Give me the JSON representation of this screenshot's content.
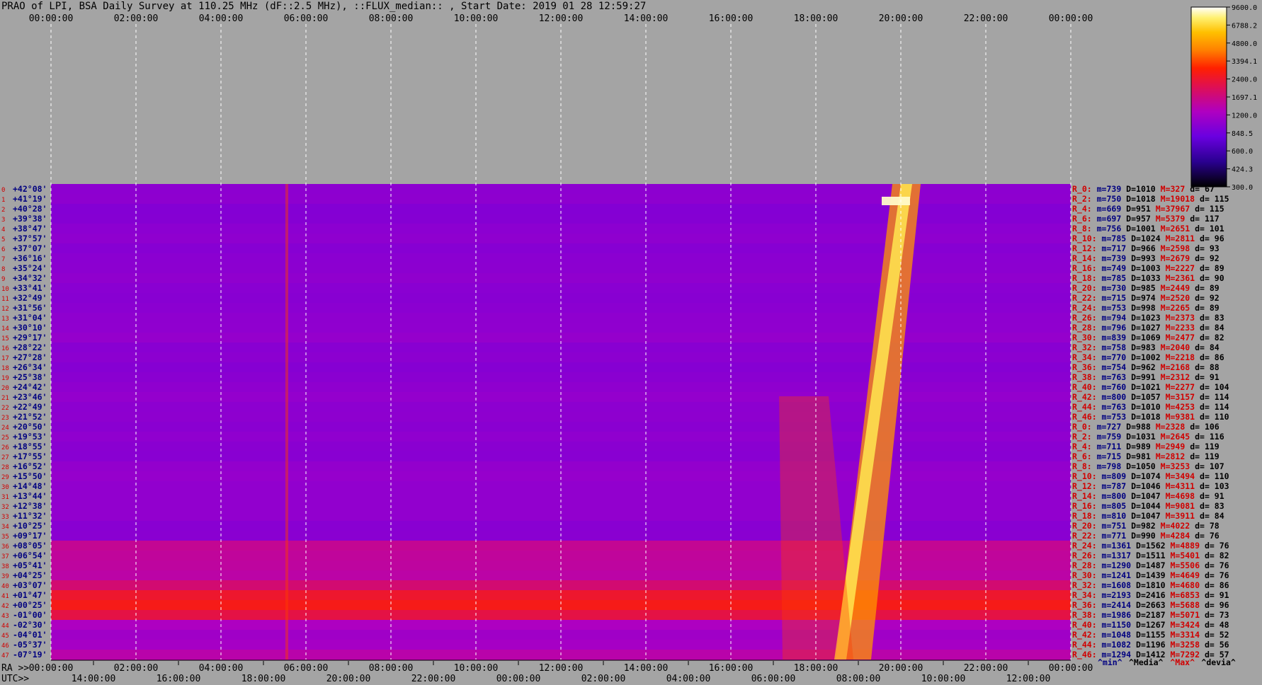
{
  "title": "PRAO of LPI, BSA Daily Survey at 110.25 MHz (dF::2.5 MHz), ::FLUX_median:: , Start Date: 2019 01 28 12:59:27",
  "colors": {
    "background": "#a4a4a4",
    "dec_label": "#000080",
    "row_index": "#d00000",
    "stat_beam": "#d00000",
    "stat_min": "#000080",
    "stat_median": "#000000",
    "stat_max": "#d00000",
    "stat_dev": "#000000"
  },
  "bottom_labels": {
    "ra": "RA >>",
    "utc": "UTC>>"
  },
  "legend_footer": [
    "^min^",
    "^Media^",
    "^Max^",
    "^devia^"
  ],
  "chart_data": {
    "type": "heatmap",
    "top_axis_ticks": [
      "00:00:00",
      "02:00:00",
      "04:00:00",
      "06:00:00",
      "08:00:00",
      "10:00:00",
      "12:00:00",
      "14:00:00",
      "16:00:00",
      "18:00:00",
      "20:00:00",
      "22:00:00",
      "00:00:00"
    ],
    "ra_ticks": [
      "00:00:00",
      "02:00:00",
      "04:00:00",
      "06:00:00",
      "08:00:00",
      "10:00:00",
      "12:00:00",
      "14:00:00",
      "16:00:00",
      "18:00:00",
      "20:00:00",
      "22:00:00",
      "00:00:00"
    ],
    "utc_ticks": [
      "14:00:00",
      "16:00:00",
      "18:00:00",
      "20:00:00",
      "22:00:00",
      "00:00:00",
      "02:00:00",
      "04:00:00",
      "06:00:00",
      "08:00:00",
      "10:00:00",
      "12:00:00"
    ],
    "colorbar": {
      "ticks": [
        "9600.0",
        "6788.2",
        "4800.0",
        "3394.1",
        "2400.0",
        "1697.1",
        "1200.0",
        "848.5",
        "600.0",
        "424.3",
        "300.0"
      ],
      "range": [
        300,
        9600
      ],
      "scale": "log"
    },
    "declinations": [
      "+42°08'",
      "+41°19'",
      "+40°28'",
      "+39°38'",
      "+38°47'",
      "+37°57'",
      "+37°07'",
      "+36°16'",
      "+35°24'",
      "+34°32'",
      "+33°41'",
      "+32°49'",
      "+31°56'",
      "+31°04'",
      "+30°10'",
      "+29°17'",
      "+28°22'",
      "+27°28'",
      "+26°34'",
      "+25°38'",
      "+24°42'",
      "+23°46'",
      "+22°49'",
      "+21°52'",
      "+20°50'",
      "+19°53'",
      "+18°55'",
      "+17°55'",
      "+16°52'",
      "+15°50'",
      "+14°48'",
      "+13°44'",
      "+12°38'",
      "+11°32'",
      "+10°25'",
      "+09°17'",
      "+08°05'",
      "+06°54'",
      "+05°41'",
      "+04°25'",
      "+03°07'",
      "+01°47'",
      "+00°25'",
      "-01°00'",
      "-02°30'",
      "-04°01'",
      "-05°37'",
      "-07°19'"
    ],
    "beam_stats": [
      {
        "beam": "R_0:",
        "min": "m=739",
        "median": "D=1010",
        "max": "M=327",
        "dev": "d= 67"
      },
      {
        "beam": "R_2:",
        "min": "m=750",
        "median": "D=1018",
        "max": "M=19018",
        "dev": "d= 115"
      },
      {
        "beam": "R_4:",
        "min": "m=669",
        "median": "D=951",
        "max": "M=37967",
        "dev": "d= 115"
      },
      {
        "beam": "R_6:",
        "min": "m=697",
        "median": "D=957",
        "max": "M=5379",
        "dev": "d= 117"
      },
      {
        "beam": "R_8:",
        "min": "m=756",
        "median": "D=1001",
        "max": "M=2651",
        "dev": "d= 101"
      },
      {
        "beam": "R_10:",
        "min": "m=785",
        "median": "D=1024",
        "max": "M=2811",
        "dev": "d= 96"
      },
      {
        "beam": "R_12:",
        "min": "m=717",
        "median": "D=966",
        "max": "M=2598",
        "dev": "d= 93"
      },
      {
        "beam": "R_14:",
        "min": "m=739",
        "median": "D=993",
        "max": "M=2679",
        "dev": "d= 92"
      },
      {
        "beam": "R_16:",
        "min": "m=749",
        "median": "D=1003",
        "max": "M=2227",
        "dev": "d= 89"
      },
      {
        "beam": "R_18:",
        "min": "m=785",
        "median": "D=1033",
        "max": "M=2361",
        "dev": "d= 90"
      },
      {
        "beam": "R_20:",
        "min": "m=730",
        "median": "D=985",
        "max": "M=2449",
        "dev": "d= 89"
      },
      {
        "beam": "R_22:",
        "min": "m=715",
        "median": "D=974",
        "max": "M=2520",
        "dev": "d= 92"
      },
      {
        "beam": "R_24:",
        "min": "m=753",
        "median": "D=998",
        "max": "M=2265",
        "dev": "d= 89"
      },
      {
        "beam": "R_26:",
        "min": "m=794",
        "median": "D=1023",
        "max": "M=2373",
        "dev": "d= 83"
      },
      {
        "beam": "R_28:",
        "min": "m=796",
        "median": "D=1027",
        "max": "M=2233",
        "dev": "d= 84"
      },
      {
        "beam": "R_30:",
        "min": "m=839",
        "median": "D=1069",
        "max": "M=2477",
        "dev": "d= 82"
      },
      {
        "beam": "R_32:",
        "min": "m=758",
        "median": "D=983",
        "max": "M=2040",
        "dev": "d= 84"
      },
      {
        "beam": "R_34:",
        "min": "m=770",
        "median": "D=1002",
        "max": "M=2218",
        "dev": "d= 86"
      },
      {
        "beam": "R_36:",
        "min": "m=754",
        "median": "D=962",
        "max": "M=2168",
        "dev": "d= 88"
      },
      {
        "beam": "R_38:",
        "min": "m=763",
        "median": "D=991",
        "max": "M=2312",
        "dev": "d= 91"
      },
      {
        "beam": "R_40:",
        "min": "m=760",
        "median": "D=1021",
        "max": "M=2277",
        "dev": "d= 104"
      },
      {
        "beam": "R_42:",
        "min": "m=800",
        "median": "D=1057",
        "max": "M=3157",
        "dev": "d= 114"
      },
      {
        "beam": "R_44:",
        "min": "m=763",
        "median": "D=1010",
        "max": "M=4253",
        "dev": "d= 114"
      },
      {
        "beam": "R_46:",
        "min": "m=753",
        "median": "D=1018",
        "max": "M=9381",
        "dev": "d= 110"
      },
      {
        "beam": "R_0:",
        "min": "m=727",
        "median": "D=988",
        "max": "M=2328",
        "dev": "d= 106"
      },
      {
        "beam": "R_2:",
        "min": "m=759",
        "median": "D=1031",
        "max": "M=2645",
        "dev": "d= 116"
      },
      {
        "beam": "R_4:",
        "min": "m=711",
        "median": "D=989",
        "max": "M=2949",
        "dev": "d= 119"
      },
      {
        "beam": "R_6:",
        "min": "m=715",
        "median": "D=981",
        "max": "M=2812",
        "dev": "d= 119"
      },
      {
        "beam": "R_8:",
        "min": "m=798",
        "median": "D=1050",
        "max": "M=3253",
        "dev": "d= 107"
      },
      {
        "beam": "R_10:",
        "min": "m=809",
        "median": "D=1074",
        "max": "M=3494",
        "dev": "d= 110"
      },
      {
        "beam": "R_12:",
        "min": "m=787",
        "median": "D=1046",
        "max": "M=4311",
        "dev": "d= 103"
      },
      {
        "beam": "R_14:",
        "min": "m=800",
        "median": "D=1047",
        "max": "M=4698",
        "dev": "d= 91"
      },
      {
        "beam": "R_16:",
        "min": "m=805",
        "median": "D=1044",
        "max": "M=9081",
        "dev": "d= 83"
      },
      {
        "beam": "R_18:",
        "min": "m=810",
        "median": "D=1047",
        "max": "M=3911",
        "dev": "d= 84"
      },
      {
        "beam": "R_20:",
        "min": "m=751",
        "median": "D=982",
        "max": "M=4022",
        "dev": "d= 78"
      },
      {
        "beam": "R_22:",
        "min": "m=771",
        "median": "D=990",
        "max": "M=4284",
        "dev": "d= 76"
      },
      {
        "beam": "R_24:",
        "min": "m=1361",
        "median": "D=1562",
        "max": "M=4889",
        "dev": "d= 76"
      },
      {
        "beam": "R_26:",
        "min": "m=1317",
        "median": "D=1511",
        "max": "M=5401",
        "dev": "d= 82"
      },
      {
        "beam": "R_28:",
        "min": "m=1290",
        "median": "D=1487",
        "max": "M=5506",
        "dev": "d= 76"
      },
      {
        "beam": "R_30:",
        "min": "m=1241",
        "median": "D=1439",
        "max": "M=4649",
        "dev": "d= 76"
      },
      {
        "beam": "R_32:",
        "min": "m=1608",
        "median": "D=1810",
        "max": "M=4680",
        "dev": "d= 86"
      },
      {
        "beam": "R_34:",
        "min": "m=2193",
        "median": "D=2416",
        "max": "M=6853",
        "dev": "d= 91"
      },
      {
        "beam": "R_36:",
        "min": "m=2414",
        "median": "D=2663",
        "max": "M=5688",
        "dev": "d= 96"
      },
      {
        "beam": "R_38:",
        "min": "m=1986",
        "median": "D=2187",
        "max": "M=5071",
        "dev": "d= 73"
      },
      {
        "beam": "R_40:",
        "min": "m=1150",
        "median": "D=1267",
        "max": "M=3424",
        "dev": "d= 48"
      },
      {
        "beam": "R_42:",
        "min": "m=1048",
        "median": "D=1155",
        "max": "M=3314",
        "dev": "d= 52"
      },
      {
        "beam": "R_44:",
        "min": "m=1082",
        "median": "D=1196",
        "max": "M=3258",
        "dev": "d= 56"
      },
      {
        "beam": "R_46:",
        "min": "m=1294",
        "median": "D=1412",
        "max": "M=7292",
        "dev": "d= 57"
      }
    ]
  }
}
